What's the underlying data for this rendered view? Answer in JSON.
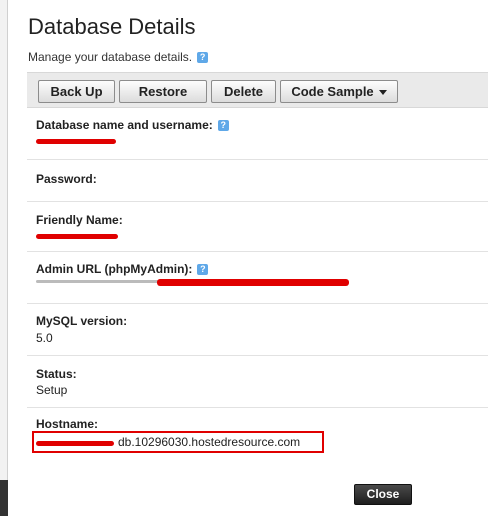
{
  "dialog": {
    "title": "Database Details",
    "subtitle": "Manage your database details.",
    "help_icon": "?"
  },
  "toolbar": {
    "backup_label": "Back Up",
    "restore_label": "Restore",
    "delete_label": "Delete",
    "code_sample_label": "Code Sample"
  },
  "fields": {
    "db_name": {
      "label": "Database name and username:",
      "redacted": true
    },
    "password": {
      "label": "Password:"
    },
    "friendly_name": {
      "label": "Friendly Name:",
      "redacted": true
    },
    "admin_url": {
      "label": "Admin URL (phpMyAdmin):",
      "redacted": true
    },
    "mysql_version": {
      "label": "MySQL version:",
      "value": "5.0"
    },
    "status": {
      "label": "Status:",
      "value": "Setup"
    },
    "hostname": {
      "label": "Hostname:",
      "value": "db.10296030.hostedresource.com",
      "redacted_prefix": true
    }
  },
  "footer": {
    "close_label": "Close"
  },
  "colors": {
    "redaction": "#e00000",
    "help_icon": "#5fa8e8",
    "close_button": "#2a2a2a"
  }
}
